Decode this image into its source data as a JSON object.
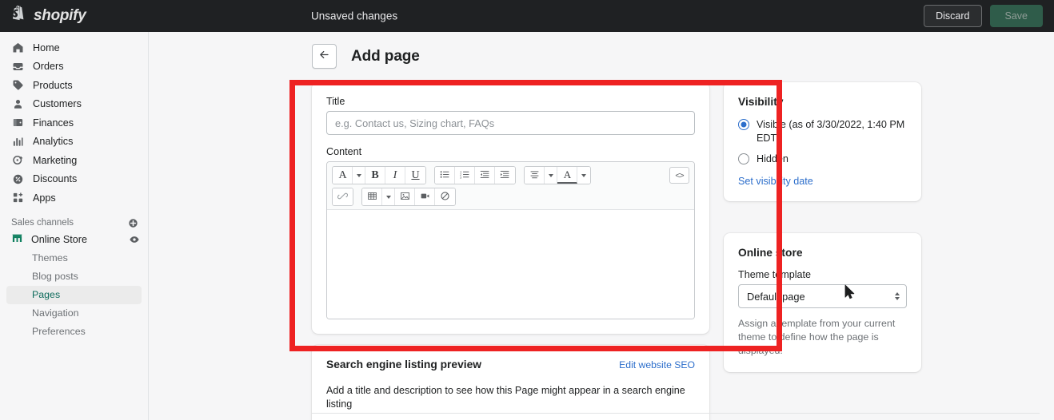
{
  "topbar": {
    "brand": "shopify",
    "brand_logo_icon": "shopify-bag-logo",
    "status": "Unsaved changes",
    "discard_label": "Discard",
    "save_label": "Save"
  },
  "sidebar": {
    "items": [
      {
        "label": "Home",
        "icon": "home-icon"
      },
      {
        "label": "Orders",
        "icon": "orders-inbox-icon"
      },
      {
        "label": "Products",
        "icon": "products-tag-icon"
      },
      {
        "label": "Customers",
        "icon": "customers-person-icon"
      },
      {
        "label": "Finances",
        "icon": "finances-wallet-icon"
      },
      {
        "label": "Analytics",
        "icon": "analytics-bars-icon"
      },
      {
        "label": "Marketing",
        "icon": "marketing-target-icon"
      },
      {
        "label": "Discounts",
        "icon": "discounts-percent-icon"
      },
      {
        "label": "Apps",
        "icon": "apps-grid-icon"
      }
    ],
    "sales_channels": {
      "label": "Sales channels",
      "add_icon": "plus-circle-icon",
      "channel": "Online Store",
      "channel_icon": "storefront-icon",
      "preview_icon": "eye-icon",
      "subitems": [
        {
          "label": "Themes",
          "active": false
        },
        {
          "label": "Blog posts",
          "active": false
        },
        {
          "label": "Pages",
          "active": true
        },
        {
          "label": "Navigation",
          "active": false
        },
        {
          "label": "Preferences",
          "active": false
        }
      ]
    }
  },
  "page": {
    "back_icon": "arrow-left-icon",
    "title": "Add page"
  },
  "form": {
    "title_label": "Title",
    "title_value": "",
    "title_placeholder": "e.g. Contact us, Sizing chart, FAQs",
    "content_label": "Content",
    "content_value": ""
  },
  "editor_toolbar": {
    "row1": [
      {
        "name": "font-style-button",
        "glyph": "A",
        "caret": true
      },
      {
        "name": "bold-button",
        "glyph": "B",
        "caret": false
      },
      {
        "name": "italic-button",
        "glyph": "I",
        "caret": false
      },
      {
        "name": "underline-button",
        "glyph": "U",
        "caret": false
      }
    ],
    "row1b": [
      {
        "name": "bulleted-list-button",
        "glyph": "bulleted-list-icon"
      },
      {
        "name": "numbered-list-button",
        "glyph": "numbered-list-icon"
      },
      {
        "name": "outdent-button",
        "glyph": "outdent-icon"
      },
      {
        "name": "indent-button",
        "glyph": "indent-icon"
      }
    ],
    "row1c": [
      {
        "name": "align-button",
        "glyph": "align-icon",
        "caret": true
      },
      {
        "name": "text-color-button",
        "glyph": "A",
        "caret": true
      }
    ],
    "code_button": {
      "name": "html-code-button",
      "glyph": "<>"
    },
    "row2": [
      {
        "name": "insert-link-button",
        "glyph": "link-chain-icon"
      },
      {
        "name": "insert-table-button",
        "glyph": "table-grid-icon",
        "caret": true
      },
      {
        "name": "insert-image-button",
        "glyph": "image-icon"
      },
      {
        "name": "insert-video-button",
        "glyph": "video-camera-icon"
      },
      {
        "name": "clear-formatting-button",
        "glyph": "clear-formatting-icon"
      }
    ]
  },
  "visibility": {
    "title": "Visibility",
    "visible_label": "Visible (as of 3/30/2022, 1:40 PM EDT)",
    "visible_selected": true,
    "hidden_label": "Hidden",
    "set_date_link": "Set visibility date"
  },
  "online_store": {
    "title": "Online store",
    "template_label": "Theme template",
    "template_value": "Default page",
    "help": "Assign a template from your current theme to define how the page is displayed."
  },
  "seo": {
    "title": "Search engine listing preview",
    "edit_link": "Edit website SEO",
    "body": "Add a title and description to see how this Page might appear in a search engine listing"
  },
  "colors": {
    "topbar_bg": "#1f2123",
    "page_bg": "#f6f6f7",
    "accent_link": "#2c6ecb",
    "active_nav_text": "#0e6b5c",
    "save_button_bg": "#2f5c4a",
    "annotation_red": "#ee2222"
  }
}
